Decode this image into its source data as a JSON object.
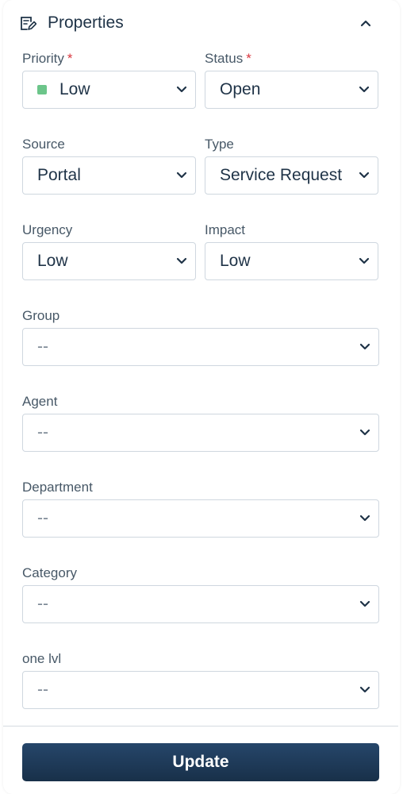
{
  "header": {
    "title": "Properties",
    "icon": "edit-note-icon",
    "collapse_icon": "chevron-up-icon"
  },
  "fields": {
    "priority": {
      "label": "Priority",
      "required_mark": "*",
      "value": "Low",
      "indicator_color": "#6cc58a"
    },
    "status": {
      "label": "Status",
      "required_mark": "*",
      "value": "Open"
    },
    "source": {
      "label": "Source",
      "value": "Portal"
    },
    "type": {
      "label": "Type",
      "value": "Service Request"
    },
    "urgency": {
      "label": "Urgency",
      "value": "Low"
    },
    "impact": {
      "label": "Impact",
      "value": "Low"
    },
    "group": {
      "label": "Group",
      "value": "--"
    },
    "agent": {
      "label": "Agent",
      "value": "--"
    },
    "department": {
      "label": "Department",
      "value": "--"
    },
    "category": {
      "label": "Category",
      "value": "--"
    },
    "one_lvl": {
      "label": "one lvl",
      "value": "--"
    }
  },
  "actions": {
    "update_label": "Update"
  },
  "colors": {
    "required": "#d9363e",
    "button": "#1f3a55",
    "text": "#1f3347"
  }
}
